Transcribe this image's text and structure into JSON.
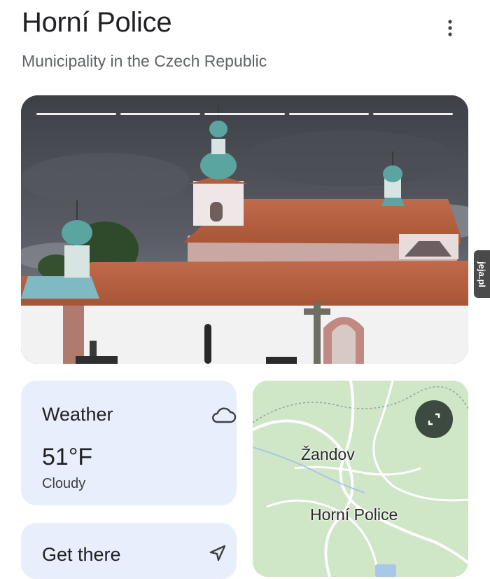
{
  "header": {
    "title": "Horní Police",
    "subtitle": "Municipality in the Czech Republic",
    "menu_icon": "more-vert-icon"
  },
  "hero": {
    "image_subject": "church-photo",
    "progress_segments": 5
  },
  "watermark": {
    "text": "jeja.pl"
  },
  "weather": {
    "label": "Weather",
    "temperature": "51°F",
    "condition": "Cloudy",
    "icon": "cloud-icon"
  },
  "map": {
    "places": [
      "Žandov",
      "Horní Police"
    ],
    "expand_icon": "expand-icon",
    "colors": {
      "land": "#cfe6c7",
      "roads": "#ffffff",
      "river": "#a9c7e8"
    }
  },
  "directions": {
    "label": "Get there",
    "icon": "directions-icon"
  },
  "colors": {
    "card_bg": "#e8eefb",
    "text_primary": "#202124",
    "text_secondary": "#5f6368"
  }
}
